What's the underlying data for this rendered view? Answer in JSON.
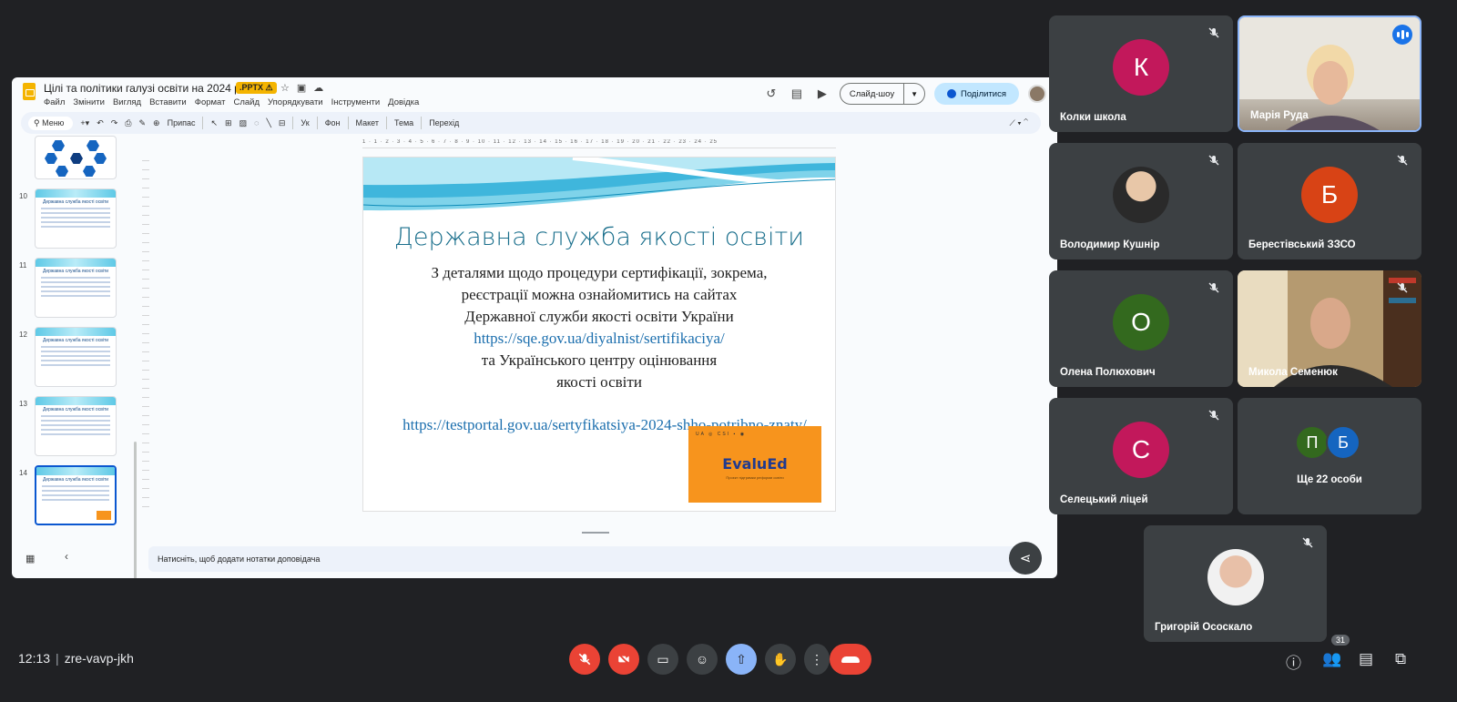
{
  "document": {
    "title": "Цілі та політики галузі освіти на 2024 рік",
    "format_badge": ".PPTX ⚠",
    "menu": [
      "Файл",
      "Змінити",
      "Вигляд",
      "Вставити",
      "Формат",
      "Слайд",
      "Упорядкувати",
      "Інструменти",
      "Довідка"
    ],
    "slideshow_label": "Слайд-шоу",
    "share_label": "Поділитися"
  },
  "toolbar": {
    "search_label": "Меню",
    "fit_label": "Припас",
    "font_label": "Ук",
    "background_label": "Фон",
    "layout_label": "Макет",
    "theme_label": "Тема",
    "transition_label": "Перехід"
  },
  "ruler": "1 · 1 · 2 · 3 · 4 · 5 · 6 · 7 · 8 · 9 · 10 · 11 · 12 · 13 · 14 · 15 · 16 · 17 · 18 · 19 · 20 · 21 · 22 · 23 · 24 · 25",
  "thumbnails": [
    {
      "num": "10",
      "title": "Державна служба якості освіти"
    },
    {
      "num": "11",
      "title": "Державна служба якості освіти"
    },
    {
      "num": "12",
      "title": "Державна служба якості освіти"
    },
    {
      "num": "13",
      "title": "Державна служба якості освіти"
    },
    {
      "num": "14",
      "title": "Державна служба якості освіти"
    }
  ],
  "slide": {
    "title": "Державна служба якості освіти",
    "line1": "З деталями щодо процедури сертифікації, зокрема,",
    "line2": "реєстрації можна ознайомитись на сайтах",
    "line3": "Державної служби якості освіти України",
    "link1": "https://sqe.gov.ua/diyalnist/sertifikaciya/",
    "line4": "та Українського центру оцінювання",
    "line5": "якості освіти",
    "link2": "https://testportal.gov.ua/sertyfikatsiya-2024-shho-potribno-znaty/",
    "logo_name": "EvaluEd",
    "logo_sub": "Проєкт підтримки реформи освіти",
    "logo_marks": "UA ◎ CSI ▪ ◉"
  },
  "notes_placeholder": "Натисніть, щоб додати нотатки доповідача",
  "participants": [
    {
      "name": "Колки школа",
      "initial": "К",
      "color": "#c2185b"
    },
    {
      "name": "Марія Руда"
    },
    {
      "name": "Володимир Кушнір"
    },
    {
      "name": "Берестівський ЗЗСО",
      "initial": "Б",
      "color": "#d84315"
    },
    {
      "name": "Олена Полюхович",
      "initial": "О",
      "color": "#33691e"
    },
    {
      "name": "Микола Семенюк"
    },
    {
      "name": "Селецький ліцей",
      "initial": "С",
      "color": "#c2185b"
    },
    {
      "name": "Григорій Ососкало"
    }
  ],
  "more_participants": {
    "label": "Ще 22 особи",
    "initials": [
      "П",
      "Б"
    ],
    "colors": [
      "#33691e",
      "#1565c0"
    ]
  },
  "meeting": {
    "time": "12:13",
    "code": "zre-vavp-jkh",
    "people_count": "31"
  },
  "colors": {
    "background": "#202124",
    "tile": "#3c4043",
    "end_call": "#ea4335",
    "active_control": "#8ab4f8"
  }
}
